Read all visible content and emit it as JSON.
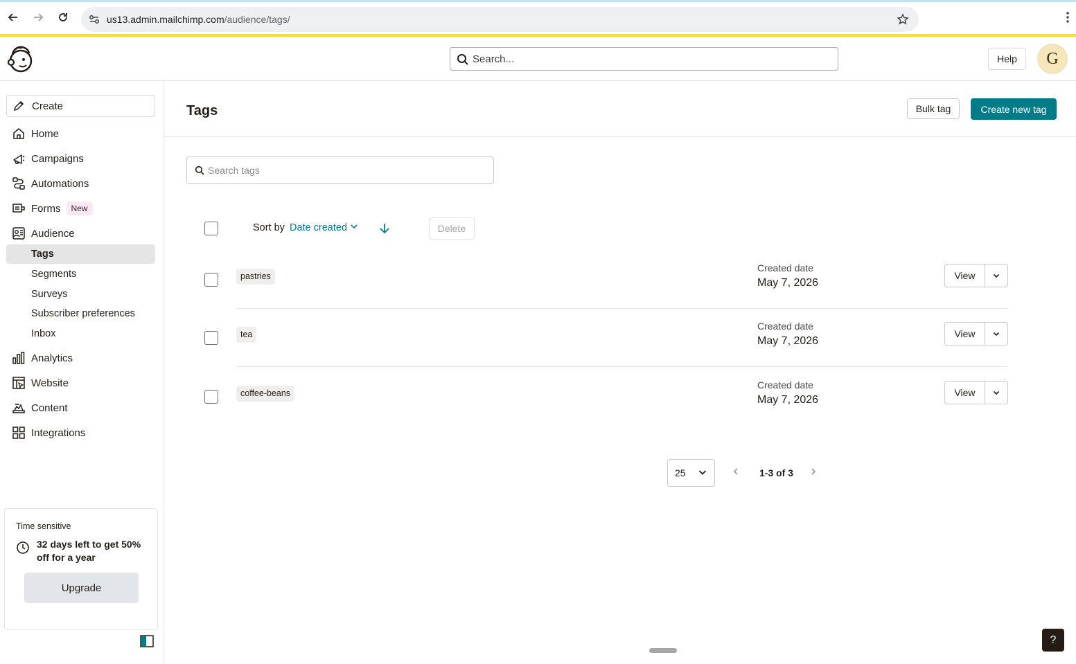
{
  "browser": {
    "url_host": "us13.admin.mailchimp.com",
    "url_path": "/audience/tags/"
  },
  "header": {
    "search_placeholder": "Search...",
    "help_label": "Help",
    "avatar_initial": "G"
  },
  "sidebar": {
    "create_label": "Create",
    "items": [
      {
        "label": "Home",
        "icon": "home-icon"
      },
      {
        "label": "Campaigns",
        "icon": "megaphone-icon"
      },
      {
        "label": "Automations",
        "icon": "automation-icon"
      },
      {
        "label": "Forms",
        "icon": "form-icon",
        "badge": "New"
      },
      {
        "label": "Audience",
        "icon": "audience-icon"
      },
      {
        "label": "Analytics",
        "icon": "bar-chart-icon"
      },
      {
        "label": "Website",
        "icon": "website-icon"
      },
      {
        "label": "Content",
        "icon": "content-icon"
      },
      {
        "label": "Integrations",
        "icon": "grid-icon"
      }
    ],
    "audience_sub": [
      "Tags",
      "Segments",
      "Surveys",
      "Subscriber preferences",
      "Inbox"
    ],
    "active_sub": "Tags",
    "promo": {
      "eyebrow": "Time sensitive",
      "message": "32 days left to get 50% off for a year",
      "button": "Upgrade"
    }
  },
  "main": {
    "title": "Tags",
    "bulk_tag_label": "Bulk tag",
    "create_tag_label": "Create new tag",
    "search_placeholder": "Search tags",
    "sort_label": "Sort by",
    "sort_value": "Date created",
    "delete_label": "Delete",
    "rows": [
      {
        "tag": "pastries",
        "date_label": "Created date",
        "date": "May 7, 2026",
        "view_label": "View"
      },
      {
        "tag": "tea",
        "date_label": "Created date",
        "date": "May 7, 2026",
        "view_label": "View"
      },
      {
        "tag": "coffee-beans",
        "date_label": "Created date",
        "date": "May 7, 2026",
        "view_label": "View"
      }
    ],
    "pagination": {
      "per_page": "25",
      "range": "1-3 of 3"
    },
    "help_fab": "?"
  },
  "colors": {
    "accent": "#007c89",
    "brand_yellow": "#ffe01b",
    "new_badge_bg": "#fde7f5"
  }
}
